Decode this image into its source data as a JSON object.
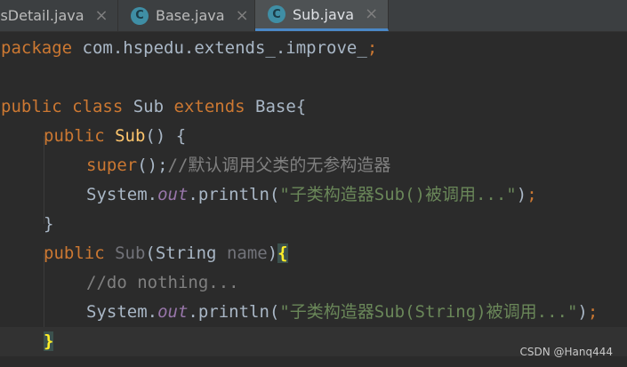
{
  "tabs": [
    {
      "label": "lsDetail.java",
      "icon": "java-class-icon",
      "active": false
    },
    {
      "label": "Base.java",
      "icon": "java-class-icon",
      "active": false
    },
    {
      "label": "Sub.java",
      "icon": "java-class-icon",
      "active": true
    }
  ],
  "tab_icon_letter": "C",
  "tab_close_glyph": "×",
  "code": {
    "l1": {
      "kw": "package",
      "rest": " com.hspedu.extends_.improve_",
      "semi": ";"
    },
    "l3": {
      "kw1": "public",
      "kw2": "class",
      "name": " Sub ",
      "kw3": "extends",
      "rest": " Base{"
    },
    "l4": {
      "kw": "public",
      "fn": "Sub",
      "rest": "() {"
    },
    "l5": {
      "kw": "super",
      "punct": "();",
      "comment": "//默认调用父类的无参构造器"
    },
    "l6": {
      "obj": "System.",
      "field": "out",
      "call": ".println(",
      "str": "\"子类构造器Sub()被调用...\"",
      "end": ")",
      "semi": ";"
    },
    "l7": {
      "text": "}"
    },
    "l8": {
      "kw": "public",
      "fn": "Sub",
      "open": "(String ",
      "param": "name",
      "close": ")",
      "brace": "{"
    },
    "l9": {
      "comment": "//do nothing..."
    },
    "l10": {
      "obj": "System.",
      "field": "out",
      "call": ".println(",
      "str": "\"子类构造器Sub(String)被调用...\"",
      "end": ")",
      "semi": ";"
    },
    "l11": {
      "brace": "}"
    }
  },
  "watermark": "CSDN @Hanq444",
  "colors": {
    "background": "#2b2b2b",
    "keyword": "#cc7832",
    "function": "#ffc66d",
    "string": "#6a8759",
    "comment": "#808080",
    "field": "#9876aa",
    "text": "#a9b7c6"
  }
}
